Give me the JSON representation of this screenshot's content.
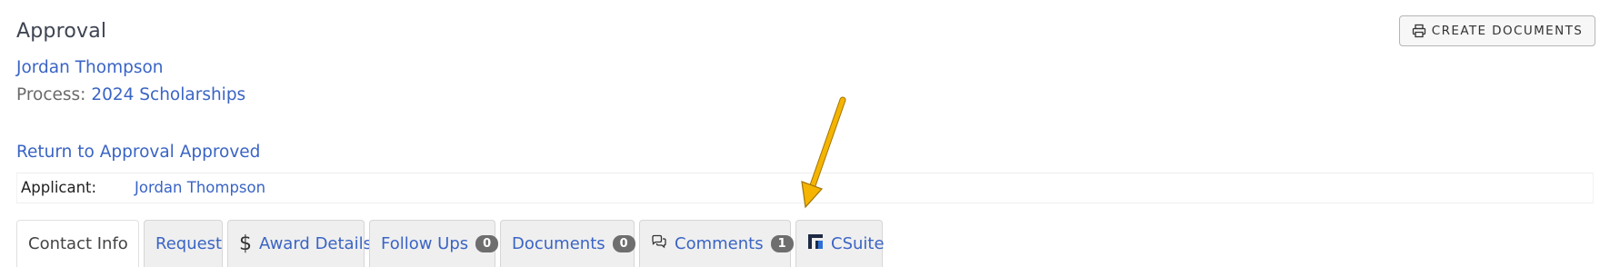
{
  "header": {
    "title": "Approval",
    "applicant_name": "Jordan Thompson",
    "process_label": "Process:",
    "process_name": "2024 Scholarships",
    "return_link": "Return to Approval Approved"
  },
  "toolbar": {
    "create_documents_label": "CREATE DOCUMENTS",
    "create_documents_icon": "printer-icon"
  },
  "applicant_row": {
    "label": "Applicant:",
    "value": "Jordan Thompson"
  },
  "tabs": [
    {
      "label": "Contact Info",
      "active": true
    },
    {
      "label": "Request",
      "active": false
    },
    {
      "label": "Award Details",
      "icon": "dollar-icon",
      "active": false
    },
    {
      "label": "Follow Ups",
      "badge": "0",
      "active": false
    },
    {
      "label": "Documents",
      "badge": "0",
      "active": false
    },
    {
      "label": "Comments",
      "icon": "comments-icon",
      "badge": "1",
      "active": false
    },
    {
      "label": "CSuite",
      "icon": "csuite-logo-icon",
      "active": false
    }
  ],
  "annotation": {
    "arrow_color": "#f5b400",
    "arrow_icon": "pointer-arrow-icon"
  },
  "colors": {
    "link": "#3a64c4",
    "badge": "#6e6e6e",
    "tab_bg": "#efefef"
  }
}
